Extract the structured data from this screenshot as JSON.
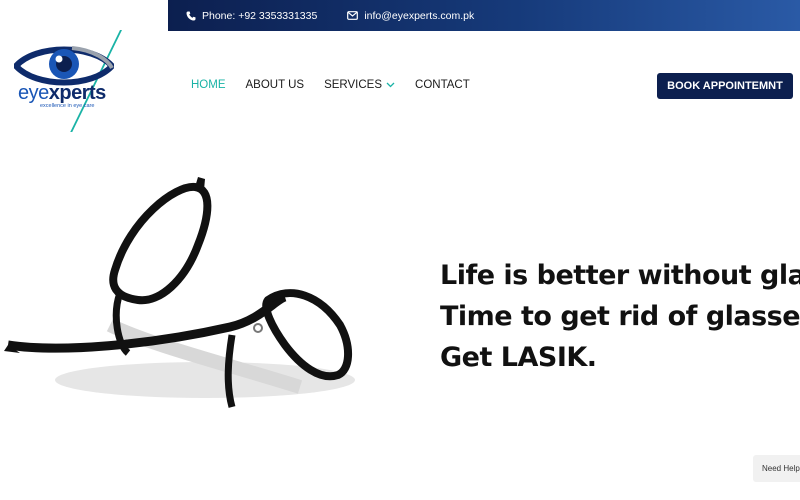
{
  "topbar": {
    "phone": "Phone: +92 3353331335",
    "email": "info@eyexperts.com.pk",
    "phone_icon": "phone-icon",
    "email_icon": "envelope-icon"
  },
  "logo": {
    "word_eye": "eye",
    "word_xperts": "xperts",
    "tagline": "excellence in eye care"
  },
  "nav": {
    "items": [
      "HOME",
      "ABOUT US",
      "SERVICES",
      "CONTACT"
    ],
    "active": "HOME",
    "services_icon": "chevron-down-icon"
  },
  "cta": {
    "label": "BOOK APPOINTEMNT"
  },
  "hero": {
    "lines": [
      "Life is better without glasses.",
      "Time to get rid of glasses.",
      "Get LASIK."
    ]
  },
  "widget": {
    "label": "Need Help"
  },
  "colors": {
    "navy": "#0c1f4f",
    "teal": "#1ab3a6",
    "blue": "#1a56b6"
  }
}
